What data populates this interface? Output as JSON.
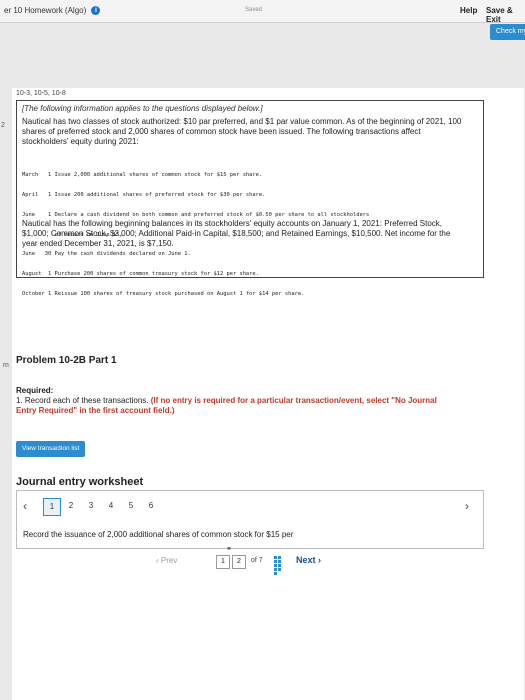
{
  "topbar": {
    "crumb": "er 10 Homework (Algo)",
    "info_icon": "info-icon",
    "saved": "Saved",
    "help": "Help",
    "save_exit": "Save & Exit",
    "check": "Check my"
  },
  "sidebar": {
    "number": "2",
    "marker": "m"
  },
  "problem": {
    "cut_title": "10-3, 10-5, 10-8",
    "note": "[The following information applies to the questions displayed below.]",
    "description": "Nautical has two classes of stock authorized: $10 par preferred, and $1 par value common. As of the beginning of 2021, 100 shares of preferred stock and 2,000 shares of common stock have been issued. The following transactions affect stockholders' equity during 2021:",
    "transactions": [
      "March   1 Issue 2,000 additional shares of common stock for $15 per share.",
      "April   1 Issue 200 additional shares of preferred stock for $30 per share.",
      "June    1 Declare a cash dividend on both common and preferred stock of $0.50 per share to all stockholders",
      "          of record on June 15.",
      "June   30 Pay the cash dividends declared on June 1.",
      "August  1 Purchase 200 shares of common treasury stock for $12 per share.",
      "October 1 Reissue 100 shares of treasury stock purchased on August 1 for $14 per share."
    ],
    "balances": "Nautical has the following beginning balances in its stockholders' equity accounts on January 1, 2021: Preferred Stock, $1,000; Common Stock, $2,000; Additional Paid-in Capital, $18,500; and Retained Earnings, $10,500. Net income for the year ended December 31, 2021, is $7,150.",
    "title": "Problem 10-2B Part 1",
    "required_label": "Required:",
    "required_text": "1. Record each of these transactions.",
    "required_bold": "(If no entry is required for a particular transaction/event, select \"No Journal Entry Required\" in the first account field.)"
  },
  "buttons": {
    "view_transaction_list": "View transaction list"
  },
  "worksheet": {
    "title": "Journal entry worksheet",
    "pages": [
      "1",
      "2",
      "3",
      "4",
      "5",
      "6"
    ],
    "active_page": "1",
    "entry_text": "Record the issuance of 2,000 additional shares of common stock for $15 per"
  },
  "navigation": {
    "prev": "Prev",
    "page1": "1",
    "page2": "2",
    "of": "of 7",
    "next": "Next"
  },
  "colors": {
    "accent": "#2c8ccd",
    "required": "#c0392b"
  }
}
